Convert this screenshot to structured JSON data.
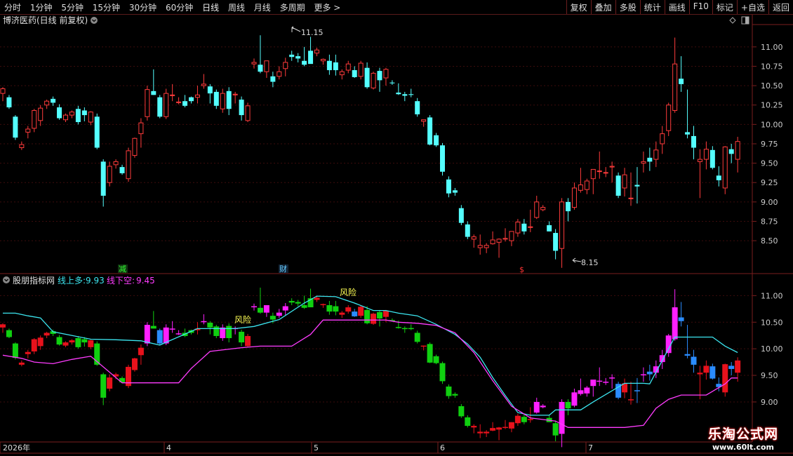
{
  "toolbar": {
    "left_items": [
      "分时",
      "1分钟",
      "5分钟",
      "15分钟",
      "30分钟",
      "60分钟",
      "日线",
      "周线",
      "月线",
      "多周期",
      "更多 >"
    ],
    "right_items": [
      "复权",
      "叠加",
      "多股",
      "统计",
      "画线",
      "F10",
      "标记",
      "+自选",
      "返回"
    ]
  },
  "main_panel": {
    "title": "博济医药(日线 前复权)",
    "y_ticks": [
      "11.00",
      "10.75",
      "10.50",
      "10.25",
      "10.00",
      "9.75",
      "9.50",
      "9.25",
      "9.00",
      "8.75",
      "8.50"
    ],
    "high_label": "11.15",
    "low_label": "8.15",
    "markers": [
      "减",
      "财",
      "$"
    ]
  },
  "indicator_panel": {
    "name": "股朋指标网",
    "line_up_label": "线上多:",
    "line_up_value": "9.93",
    "line_down_label": "线下空:",
    "line_down_value": "9.45",
    "y_ticks": [
      "11.00",
      "10.50",
      "10.00",
      "9.50",
      "9.00"
    ],
    "risk_labels": [
      "风险",
      "风险"
    ]
  },
  "x_axis": {
    "labels": [
      "2026年",
      "4",
      "5",
      "6",
      "7"
    ]
  },
  "watermark": {
    "line1": "乐淘公式网",
    "line2": "www.60lt.com"
  },
  "colors": {
    "up": "#ff3b3b",
    "down": "#54ffff",
    "upper_line": "#3ce6f0",
    "lower_line": "#ff3cff",
    "ind_up": "#e8121c",
    "ind_down_green": "#10d010",
    "ind_down_blue": "#2a8cff",
    "ind_magenta": "#ff20ff"
  },
  "chart_data": {
    "type": "candlestick",
    "ohlc_columns": [
      "open",
      "high",
      "low",
      "close"
    ],
    "ohlc": [
      [
        10.4,
        10.48,
        10.3,
        10.46
      ],
      [
        10.35,
        10.38,
        10.2,
        10.22
      ],
      [
        10.1,
        10.12,
        9.8,
        9.83
      ],
      [
        9.7,
        9.78,
        9.67,
        9.74
      ],
      [
        9.9,
        9.98,
        9.82,
        9.94
      ],
      [
        9.95,
        10.2,
        9.9,
        10.18
      ],
      [
        10.05,
        10.25,
        9.98,
        10.21
      ],
      [
        10.25,
        10.32,
        10.2,
        10.3
      ],
      [
        10.33,
        10.36,
        10.24,
        10.28
      ],
      [
        10.22,
        10.26,
        10.06,
        10.08
      ],
      [
        10.06,
        10.14,
        10.03,
        10.12
      ],
      [
        10.12,
        10.18,
        10.08,
        10.16
      ],
      [
        10.2,
        10.24,
        10.0,
        10.03
      ],
      [
        10.18,
        10.22,
        10.04,
        10.12
      ],
      [
        10.03,
        10.17,
        9.99,
        10.16
      ],
      [
        10.1,
        10.14,
        9.68,
        9.7
      ],
      [
        9.52,
        9.55,
        8.94,
        9.08
      ],
      [
        9.25,
        9.52,
        9.2,
        9.46
      ],
      [
        9.48,
        9.55,
        9.43,
        9.52
      ],
      [
        9.45,
        9.48,
        9.35,
        9.37
      ],
      [
        9.3,
        9.7,
        9.26,
        9.66
      ],
      [
        9.6,
        9.83,
        9.57,
        9.82
      ],
      [
        9.88,
        10.08,
        9.7,
        10.02
      ],
      [
        10.1,
        10.5,
        10.05,
        10.45
      ],
      [
        10.43,
        10.71,
        10.38,
        10.38
      ],
      [
        10.35,
        10.38,
        10.08,
        10.1
      ],
      [
        10.1,
        10.46,
        10.07,
        10.4
      ],
      [
        10.38,
        10.52,
        10.3,
        10.38
      ],
      [
        10.28,
        10.35,
        10.26,
        10.29
      ],
      [
        10.3,
        10.38,
        10.22,
        10.24
      ],
      [
        10.35,
        10.36,
        10.27,
        10.3
      ],
      [
        10.35,
        10.5,
        10.27,
        10.38
      ],
      [
        10.5,
        10.65,
        10.46,
        10.52
      ],
      [
        10.49,
        10.52,
        10.27,
        10.4
      ],
      [
        10.42,
        10.45,
        10.2,
        10.24
      ],
      [
        10.2,
        10.46,
        10.15,
        10.4
      ],
      [
        10.43,
        10.48,
        10.12,
        10.2
      ],
      [
        10.38,
        10.42,
        10.27,
        10.39
      ],
      [
        10.32,
        10.36,
        10.05,
        10.12
      ],
      [
        10.05,
        10.28,
        10.03,
        10.24
      ],
      [
        10.78,
        10.85,
        10.72,
        10.8
      ],
      [
        10.77,
        11.15,
        10.66,
        10.68
      ],
      [
        10.68,
        10.82,
        10.6,
        10.82
      ],
      [
        10.62,
        10.68,
        10.48,
        10.55
      ],
      [
        10.62,
        10.75,
        10.58,
        10.68
      ],
      [
        10.72,
        10.86,
        10.62,
        10.8
      ],
      [
        10.9,
        10.95,
        10.82,
        10.87
      ],
      [
        10.88,
        10.92,
        10.8,
        10.85
      ],
      [
        10.82,
        11.0,
        10.75,
        10.77
      ],
      [
        10.95,
        11.13,
        10.8,
        10.78
      ],
      [
        10.92,
        10.99,
        10.88,
        10.96
      ],
      [
        10.82,
        10.85,
        10.77,
        10.84
      ],
      [
        10.82,
        10.9,
        10.64,
        10.7
      ],
      [
        10.8,
        10.9,
        10.63,
        10.7
      ],
      [
        10.64,
        10.71,
        10.58,
        10.68
      ],
      [
        10.7,
        10.82,
        10.66,
        10.78
      ],
      [
        10.7,
        10.75,
        10.6,
        10.61
      ],
      [
        10.62,
        10.82,
        10.58,
        10.79
      ],
      [
        10.73,
        10.8,
        10.46,
        10.48
      ],
      [
        10.47,
        10.68,
        10.45,
        10.66
      ],
      [
        10.69,
        10.73,
        10.42,
        10.57
      ],
      [
        10.6,
        10.73,
        10.5,
        10.71
      ],
      [
        10.54,
        10.57,
        10.51,
        10.53
      ],
      [
        10.41,
        10.53,
        10.38,
        10.39
      ],
      [
        10.39,
        10.42,
        10.3,
        10.37
      ],
      [
        10.39,
        10.46,
        10.35,
        10.38
      ],
      [
        10.3,
        10.34,
        10.1,
        10.13
      ],
      [
        10.04,
        10.06,
        9.97,
        10.06
      ],
      [
        10.09,
        10.12,
        9.73,
        9.74
      ],
      [
        9.86,
        9.89,
        9.71,
        9.73
      ],
      [
        9.73,
        9.76,
        9.34,
        9.39
      ],
      [
        9.29,
        9.33,
        9.06,
        9.11
      ],
      [
        9.15,
        9.18,
        9.08,
        9.12
      ],
      [
        8.92,
        8.96,
        8.7,
        8.73
      ],
      [
        8.71,
        8.75,
        8.52,
        8.55
      ],
      [
        8.52,
        8.58,
        8.41,
        8.55
      ],
      [
        8.41,
        8.58,
        8.32,
        8.44
      ],
      [
        8.41,
        8.47,
        8.34,
        8.44
      ],
      [
        8.46,
        8.62,
        8.45,
        8.51
      ],
      [
        8.48,
        8.53,
        8.28,
        8.52
      ],
      [
        8.52,
        8.66,
        8.49,
        8.53
      ],
      [
        8.5,
        8.62,
        8.43,
        8.62
      ],
      [
        8.6,
        8.78,
        8.55,
        8.74
      ],
      [
        8.72,
        8.78,
        8.58,
        8.62
      ],
      [
        8.67,
        8.9,
        8.61,
        8.68
      ],
      [
        8.8,
        9.08,
        8.78,
        9.0
      ],
      [
        8.9,
        8.96,
        8.88,
        8.93
      ],
      [
        8.7,
        8.75,
        8.62,
        8.62
      ],
      [
        8.6,
        8.65,
        8.26,
        8.37
      ],
      [
        8.4,
        9.05,
        8.15,
        9.0
      ],
      [
        9.0,
        9.05,
        8.75,
        8.88
      ],
      [
        8.93,
        9.25,
        8.9,
        9.18
      ],
      [
        9.15,
        9.44,
        9.12,
        9.22
      ],
      [
        9.16,
        9.3,
        9.1,
        9.27
      ],
      [
        9.3,
        9.35,
        9.1,
        9.42
      ],
      [
        9.4,
        9.65,
        9.3,
        9.4
      ],
      [
        9.38,
        9.45,
        9.32,
        9.38
      ],
      [
        9.45,
        9.52,
        9.25,
        9.46
      ],
      [
        9.34,
        9.38,
        9.05,
        9.08
      ],
      [
        9.18,
        9.44,
        9.07,
        9.35
      ],
      [
        9.05,
        9.38,
        8.95,
        9.05
      ],
      [
        9.22,
        9.45,
        8.98,
        9.2
      ],
      [
        9.5,
        9.65,
        9.38,
        9.52
      ],
      [
        9.57,
        9.7,
        9.4,
        9.52
      ],
      [
        9.55,
        9.78,
        9.45,
        9.67
      ],
      [
        9.75,
        9.98,
        9.62,
        9.88
      ],
      [
        9.92,
        10.28,
        9.85,
        10.25
      ],
      [
        10.18,
        11.12,
        10.15,
        10.78
      ],
      [
        10.59,
        10.88,
        10.42,
        10.52
      ],
      [
        9.9,
        10.45,
        9.82,
        9.87
      ],
      [
        9.85,
        9.98,
        9.55,
        9.7
      ],
      [
        9.52,
        9.68,
        9.05,
        9.55
      ],
      [
        9.55,
        9.78,
        9.42,
        9.68
      ],
      [
        9.67,
        9.72,
        9.42,
        9.44
      ],
      [
        9.34,
        9.46,
        9.2,
        9.28
      ],
      [
        9.18,
        9.72,
        9.1,
        9.71
      ],
      [
        9.68,
        9.75,
        9.5,
        9.62
      ],
      [
        9.55,
        9.84,
        9.38,
        9.78
      ]
    ],
    "upper_line": [
      [
        0,
        10.67
      ],
      [
        2,
        10.67
      ],
      [
        4,
        10.62
      ],
      [
        6,
        10.58
      ],
      [
        8,
        10.32
      ],
      [
        14,
        10.18
      ],
      [
        18,
        10.17
      ],
      [
        22,
        10.15
      ],
      [
        25,
        10.07
      ],
      [
        31,
        10.38
      ],
      [
        37,
        10.38
      ],
      [
        40,
        10.42
      ],
      [
        44,
        10.55
      ],
      [
        48,
        10.86
      ],
      [
        50,
        10.99
      ],
      [
        53,
        10.98
      ],
      [
        56,
        10.86
      ],
      [
        59,
        10.72
      ],
      [
        61,
        10.72
      ],
      [
        63,
        10.67
      ],
      [
        66,
        10.62
      ],
      [
        69,
        10.46
      ],
      [
        72,
        10.27
      ],
      [
        74,
        10.09
      ],
      [
        76,
        9.84
      ],
      [
        78,
        9.46
      ],
      [
        80,
        9.12
      ],
      [
        82,
        8.8
      ],
      [
        84,
        8.75
      ],
      [
        87,
        8.75
      ],
      [
        88,
        8.85
      ],
      [
        90,
        8.85
      ],
      [
        92,
        8.85
      ],
      [
        94,
        9.0
      ],
      [
        99,
        9.35
      ],
      [
        102,
        9.35
      ],
      [
        103,
        9.34
      ],
      [
        107,
        10.22
      ],
      [
        113,
        10.22
      ],
      [
        115,
        10.05
      ],
      [
        117,
        9.93
      ]
    ],
    "lower_line": [
      [
        0,
        9.88
      ],
      [
        3,
        9.82
      ],
      [
        5,
        9.75
      ],
      [
        8,
        9.72
      ],
      [
        11,
        9.8
      ],
      [
        14,
        9.86
      ],
      [
        19,
        9.36
      ],
      [
        22,
        9.36
      ],
      [
        28,
        9.36
      ],
      [
        30,
        9.63
      ],
      [
        33,
        9.95
      ],
      [
        38,
        10.02
      ],
      [
        41,
        10.05
      ],
      [
        46,
        10.05
      ],
      [
        49,
        10.27
      ],
      [
        51,
        10.54
      ],
      [
        55,
        10.54
      ],
      [
        58,
        10.54
      ],
      [
        61,
        10.54
      ],
      [
        63,
        10.5
      ],
      [
        66,
        10.48
      ],
      [
        69,
        10.44
      ],
      [
        72,
        10.3
      ],
      [
        75,
        9.93
      ],
      [
        78,
        9.4
      ],
      [
        81,
        8.92
      ],
      [
        84,
        8.7
      ],
      [
        88,
        8.64
      ],
      [
        90,
        8.52
      ],
      [
        94,
        8.52
      ],
      [
        99,
        8.52
      ],
      [
        102,
        8.56
      ],
      [
        104,
        8.88
      ],
      [
        106,
        9.05
      ],
      [
        108,
        9.13
      ],
      [
        112,
        9.13
      ],
      [
        115,
        9.34
      ],
      [
        116,
        9.45
      ],
      [
        117,
        9.45
      ]
    ],
    "main_ylim": [
      8.13,
      11.27
    ],
    "indicator_ylim": [
      8.3,
      11.15
    ]
  }
}
